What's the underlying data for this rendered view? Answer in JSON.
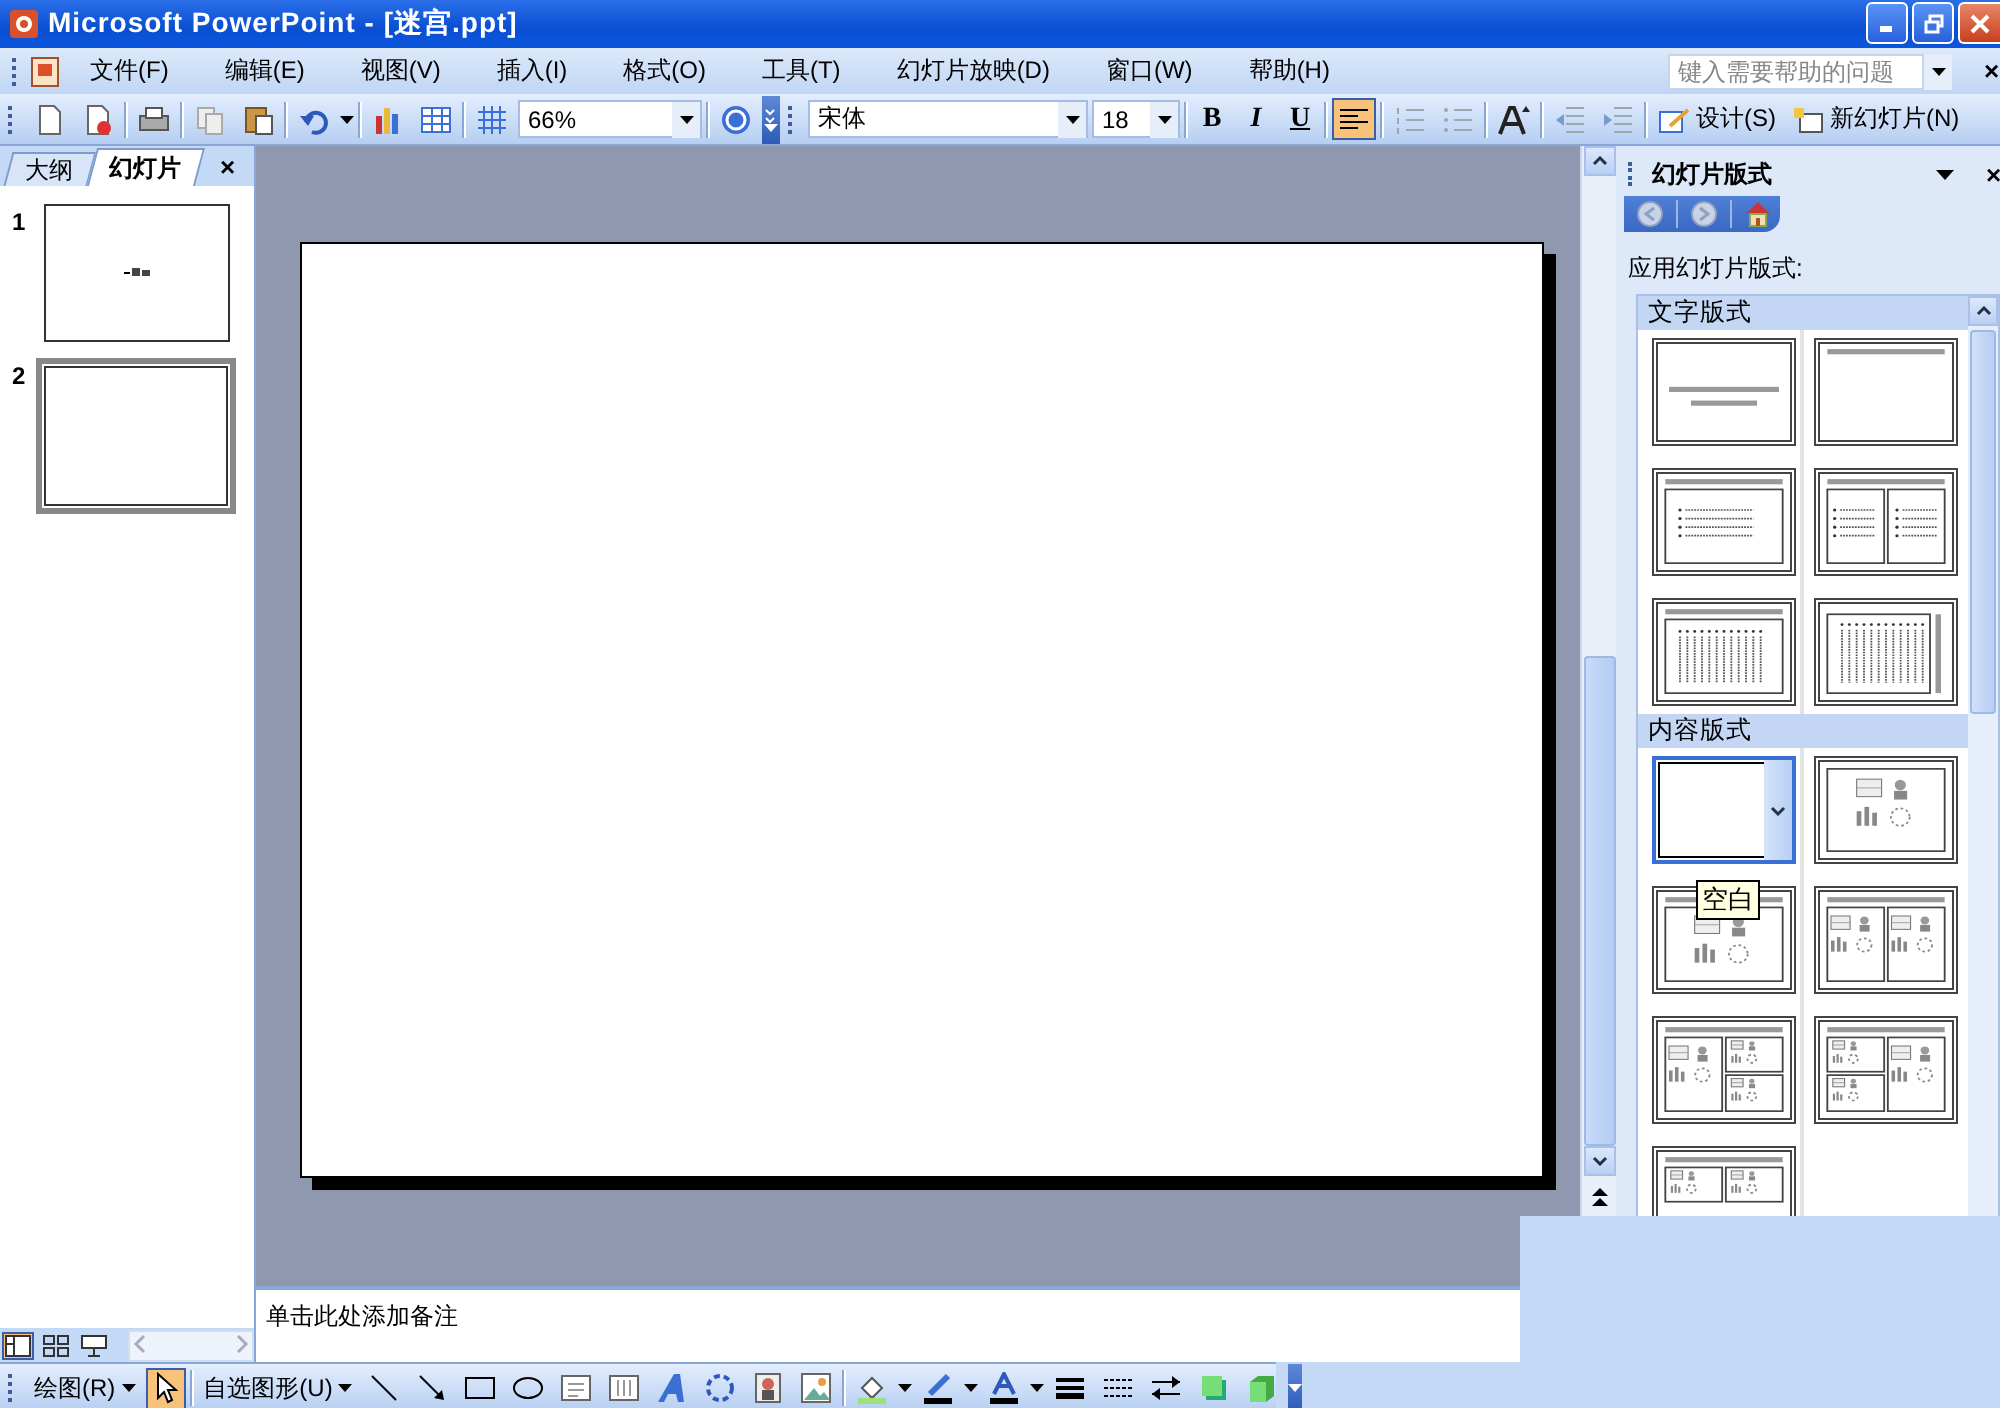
{
  "window": {
    "title": "Microsoft PowerPoint - [迷宫.ppt]"
  },
  "menu": [
    {
      "label": "文件(F)"
    },
    {
      "label": "编辑(E)"
    },
    {
      "label": "视图(V)"
    },
    {
      "label": "插入(I)"
    },
    {
      "label": "格式(O)"
    },
    {
      "label": "工具(T)"
    },
    {
      "label": "幻灯片放映(D)"
    },
    {
      "label": "窗口(W)"
    },
    {
      "label": "帮助(H)"
    }
  ],
  "help_box": {
    "placeholder": "键入需要帮助的问题",
    "close": "×"
  },
  "toolbar": {
    "zoom": "66%",
    "font": "宋体",
    "font_size": "18",
    "format_buttons": [
      "B",
      "I",
      "U"
    ],
    "align_left": {
      "selected": true
    },
    "design": "设计(S)",
    "new_slide": "新幻灯片(N)"
  },
  "left_panel": {
    "tabs": [
      {
        "label": "大纲",
        "selected": false
      },
      {
        "label": "幻灯片",
        "selected": true
      }
    ],
    "close": "×",
    "slides": [
      {
        "number": "1",
        "selected": false,
        "has_title": true
      },
      {
        "number": "2",
        "selected": true,
        "has_title": false
      }
    ]
  },
  "notes": {
    "placeholder": "单击此处添加备注"
  },
  "task_pane": {
    "title": "幻灯片版式",
    "close": "×",
    "apply_label": "应用幻灯片版式:",
    "sections": [
      {
        "title": "文字版式",
        "layouts": [
          {
            "kind": "title",
            "selected": false
          },
          {
            "kind": "title-only",
            "selected": false
          },
          {
            "kind": "title-text",
            "selected": false
          },
          {
            "kind": "title-two-text",
            "selected": false
          },
          {
            "kind": "title-vertical-text",
            "selected": false
          },
          {
            "kind": "vertical-title-text",
            "selected": false
          }
        ]
      },
      {
        "title": "内容版式",
        "layouts": [
          {
            "kind": "blank",
            "selected": true,
            "tooltip": "空白"
          },
          {
            "kind": "content",
            "selected": false
          },
          {
            "kind": "title-content",
            "selected": false
          },
          {
            "kind": "title-two-content",
            "selected": false
          },
          {
            "kind": "title-content-four",
            "selected": false
          },
          {
            "kind": "title-four-content",
            "selected": false
          },
          {
            "kind": "title-four-four",
            "selected": false
          }
        ]
      }
    ]
  },
  "drawing_toolbar": {
    "draw_menu": "绘图(R)",
    "select_tool": {
      "selected": true
    },
    "autoshapes": "自选图形(U)"
  }
}
